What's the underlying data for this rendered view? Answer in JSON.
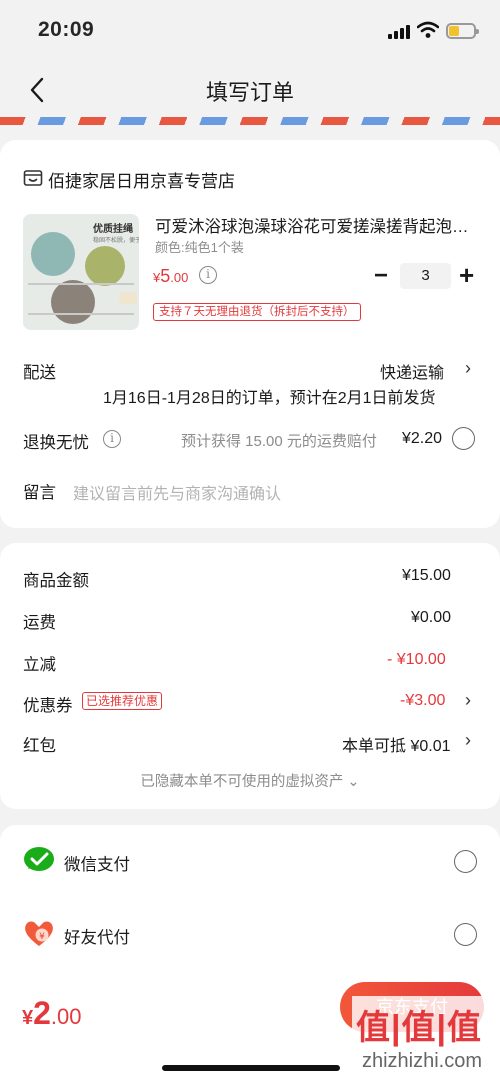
{
  "status_bar": {
    "time": "20:09"
  },
  "nav": {
    "title": "填写订单"
  },
  "store": {
    "name": "佰捷家居日用京喜专营店",
    "product": {
      "title": "可爱沐浴球泡澡球浴花可爱搓澡搓背起泡…",
      "variant": "颜色:纯色1个装",
      "image_label": "优质挂绳",
      "image_sub": "稳固不松脱，便于收纳",
      "price_symbol": "¥",
      "price_int": "5",
      "price_dec": ".00",
      "quantity": "3",
      "minus": "−",
      "plus": "+",
      "return_policy": "支持７天无理由退货（拆封后不支持）"
    },
    "delivery": {
      "label": "配送",
      "method": "快递运输",
      "note": "1月16日-1月28日的订单，预计在2月1日前发货"
    },
    "return_insurance": {
      "label": "退换无忧",
      "description": "预计获得 15.00 元的运费赔付",
      "price": "¥2.20"
    },
    "message": {
      "label": "留言",
      "placeholder": "建议留言前先与商家沟通确认"
    }
  },
  "summary": {
    "goods_label": "商品金额",
    "goods_value": "¥15.00",
    "shipping_label": "运费",
    "shipping_value": "¥0.00",
    "discount_label": "立减",
    "discount_value": "- ¥10.00",
    "coupon_label": "优惠券",
    "coupon_badge": "已选推荐优惠",
    "coupon_value": "-¥3.00",
    "redpacket_label": "红包",
    "redpacket_value": "本单可抵 ¥0.01",
    "hidden_assets": "已隐藏本单不可使用的虚拟资产 ⌄"
  },
  "payment": {
    "wechat_label": "微信支付",
    "friend_label": "好友代付"
  },
  "footer": {
    "total_symbol": "¥",
    "total_int": "2",
    "total_dec": ".00",
    "pay_button": "京东支付",
    "watermark_logo": "值|值|值",
    "watermark_text": "zhizhizhi.com"
  },
  "colors": {
    "accent": "#e4393c",
    "wechat_green": "#1aad19",
    "background": "#f2f2f2"
  }
}
